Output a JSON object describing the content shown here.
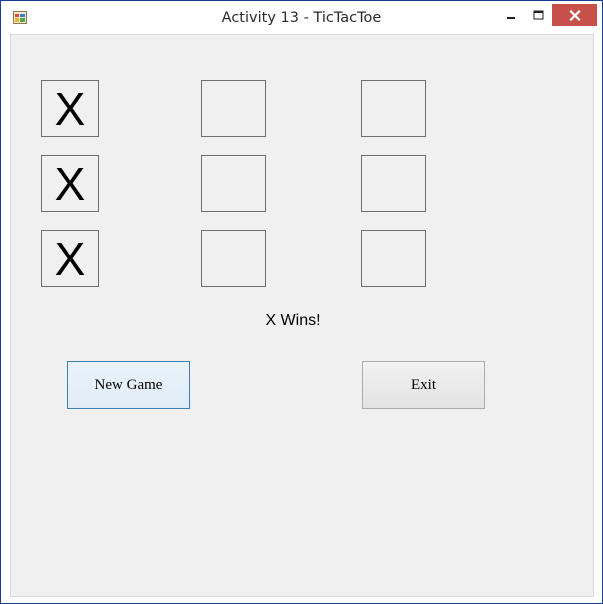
{
  "window": {
    "title": "Activity 13 - TicTacToe",
    "icon": "windows-form-icon",
    "controls": {
      "minimize": "minimize-icon",
      "maximize": "maximize-icon",
      "close": "close-icon"
    },
    "colors": {
      "close_button": "#c7504b",
      "client_background": "#f0f0f0",
      "frame_border": "#1a3f8f"
    }
  },
  "board": {
    "rows": [
      [
        "X",
        "",
        ""
      ],
      [
        "X",
        "",
        ""
      ],
      [
        "X",
        "",
        ""
      ]
    ]
  },
  "status": {
    "text": "X Wins!"
  },
  "buttons": {
    "new_game": "New Game",
    "exit": "Exit"
  }
}
